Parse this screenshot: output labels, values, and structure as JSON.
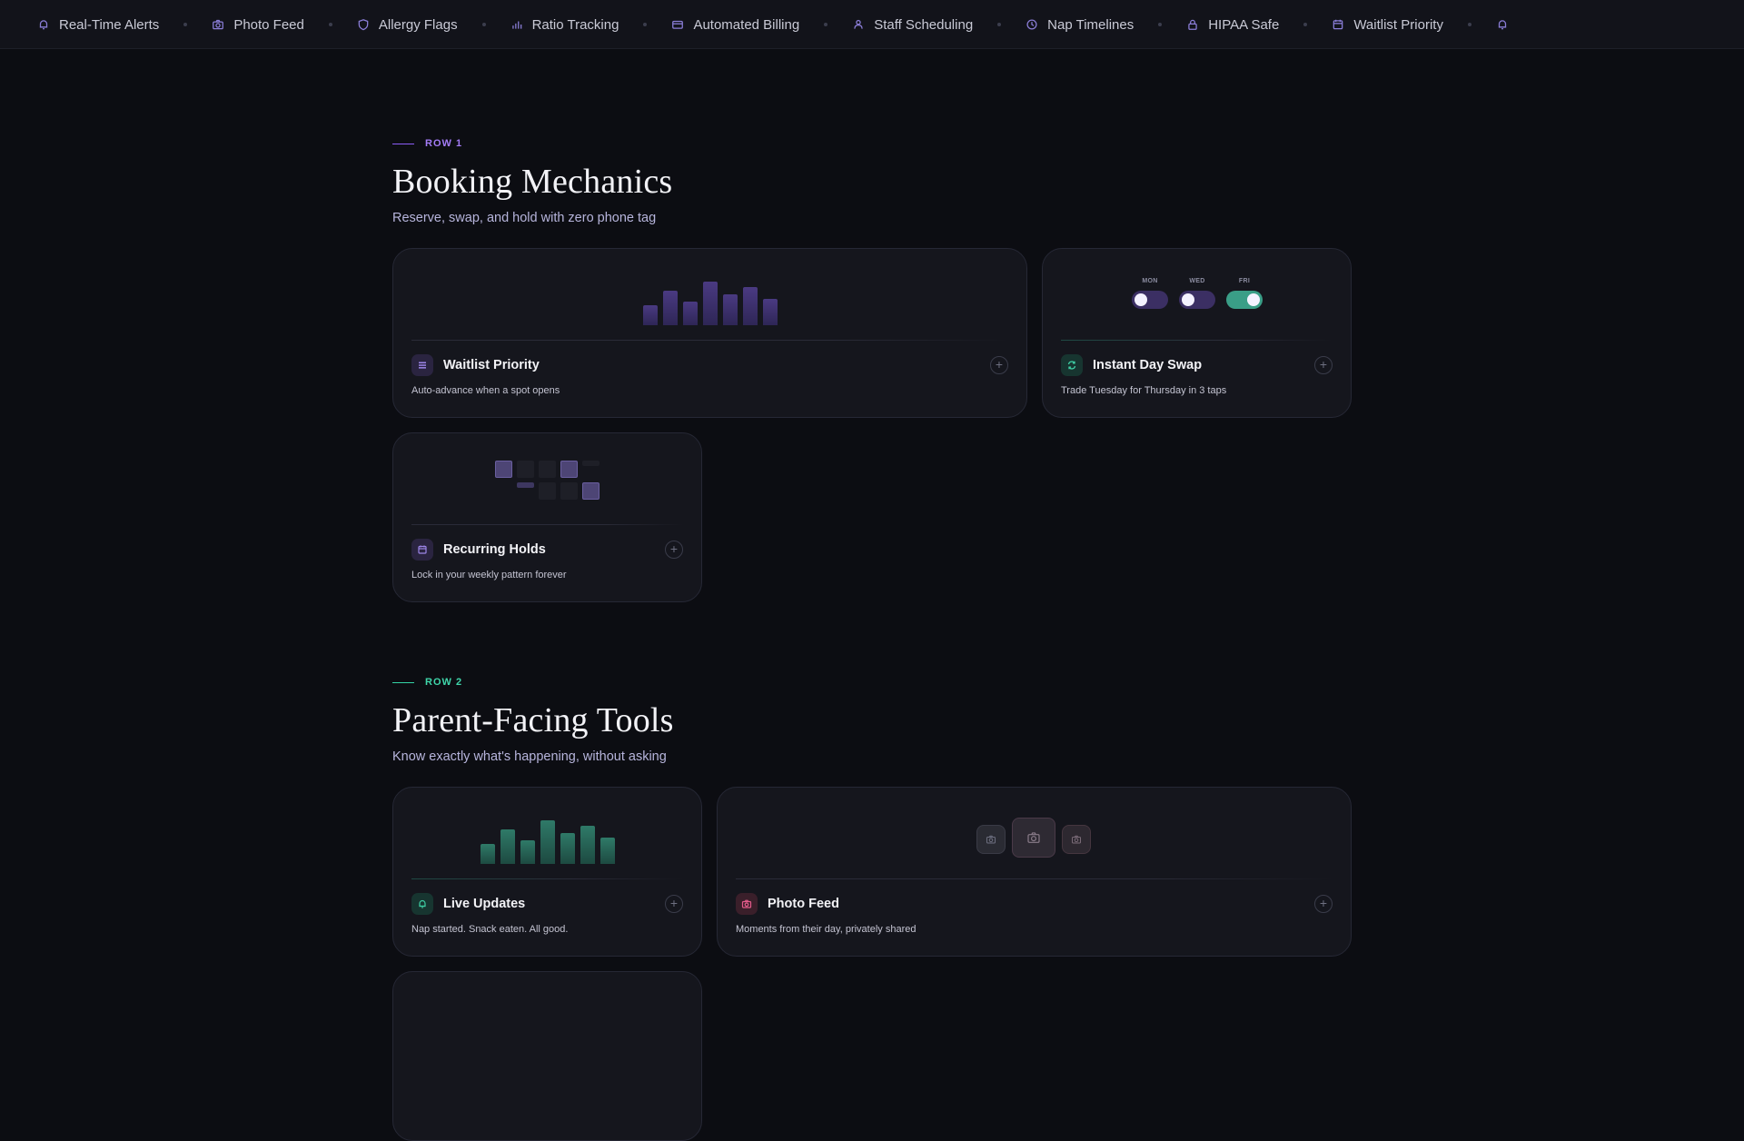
{
  "ticker": {
    "items": [
      {
        "label": "Real-Time Alerts",
        "icon": "bell-icon"
      },
      {
        "label": "Photo Feed",
        "icon": "camera-icon"
      },
      {
        "label": "Allergy Flags",
        "icon": "shield-icon"
      },
      {
        "label": "Ratio Tracking",
        "icon": "bar-chart-icon"
      },
      {
        "label": "Automated Billing",
        "icon": "credit-card-icon"
      },
      {
        "label": "Staff Scheduling",
        "icon": "staff-icon"
      },
      {
        "label": "Nap Timelines",
        "icon": "clock-icon"
      },
      {
        "label": "HIPAA Safe",
        "icon": "lock-icon"
      },
      {
        "label": "Waitlist Priority",
        "icon": "calendar-icon"
      }
    ]
  },
  "row1": {
    "eyebrow": "ROW 1",
    "title": "Booking Mechanics",
    "subtitle": "Reserve, swap, and hold with zero phone tag",
    "cards": [
      {
        "title": "Waitlist Priority",
        "desc": "Auto-advance when a spot opens",
        "icon": "list-icon"
      },
      {
        "title": "Instant Day Swap",
        "desc": "Trade Tuesday for Thursday in 3 taps",
        "icon": "swap-icon",
        "toggles": [
          {
            "label": "MON",
            "on": false
          },
          {
            "label": "WED",
            "on": false
          },
          {
            "label": "FRI",
            "on": true
          }
        ]
      },
      {
        "title": "Recurring Holds",
        "desc": "Lock in your weekly pattern forever",
        "icon": "calendar-icon"
      }
    ]
  },
  "row2": {
    "eyebrow": "ROW 2",
    "title": "Parent-Facing Tools",
    "subtitle": "Know exactly what's happening, without asking",
    "cards": [
      {
        "title": "Live Updates",
        "desc": "Nap started. Snack eaten. All good.",
        "icon": "bell-icon"
      },
      {
        "title": "Photo Feed",
        "desc": "Moments from their day, privately shared",
        "icon": "camera-icon"
      }
    ]
  },
  "colors": {
    "accent_purple": "#8b5cf6",
    "accent_teal": "#34d3a6",
    "accent_pink": "#e25b8a",
    "background": "#0c0d12",
    "card": "#15161d"
  },
  "visuals": {
    "waitlist_bar_levels": [
      0.45,
      0.8,
      0.55,
      1.0,
      0.7,
      0.88,
      0.6
    ],
    "live_bar_levels": [
      0.45,
      0.8,
      0.55,
      1.0,
      0.7,
      0.88,
      0.6
    ]
  }
}
